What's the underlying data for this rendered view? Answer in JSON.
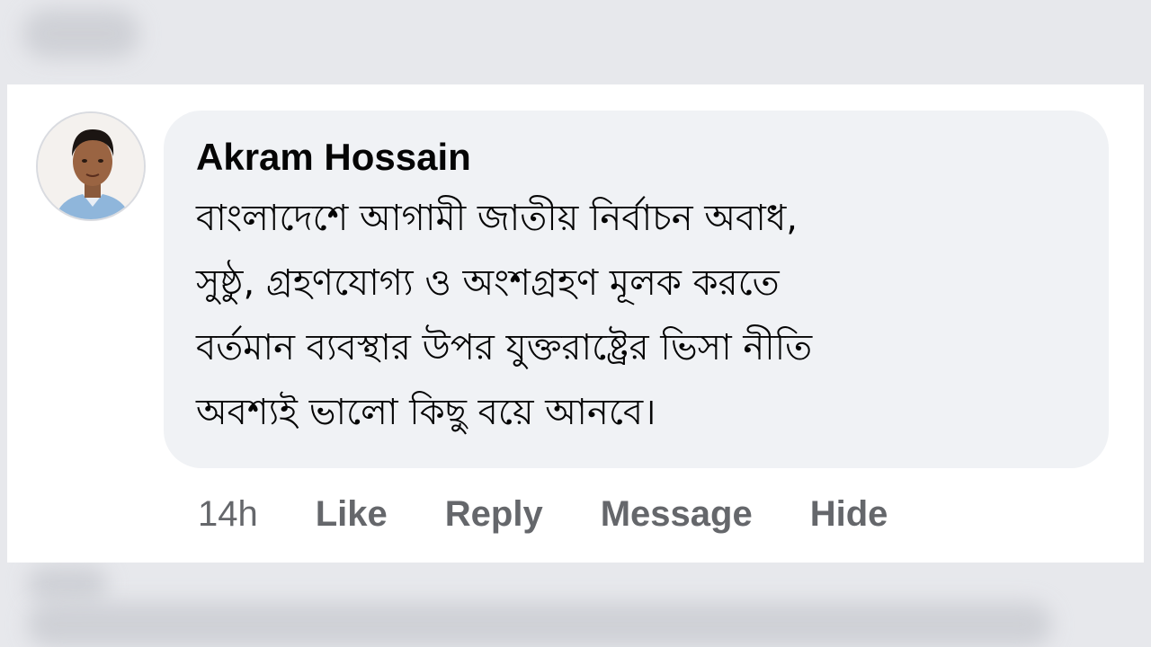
{
  "comment": {
    "author": "Akram Hossain",
    "text_lines": [
      "বাংলাদেশে আগামী জাতীয় নির্বাচন অবাধ,",
      "সুষ্ঠু, গ্রহণযোগ্য ও অংশগ্রহণ মূলক করতে",
      "বর্তমান ব্যবস্থার উপর যুক্তরাষ্ট্রের ভিসা নীতি",
      "অবশ্যই ভালো কিছু বয়ে আনবে।"
    ],
    "timestamp": "14h"
  },
  "actions": {
    "like": "Like",
    "reply": "Reply",
    "message": "Message",
    "hide": "Hide"
  },
  "colors": {
    "bubble": "#f0f2f5",
    "action_text": "#65676b",
    "author_text": "#050505"
  }
}
